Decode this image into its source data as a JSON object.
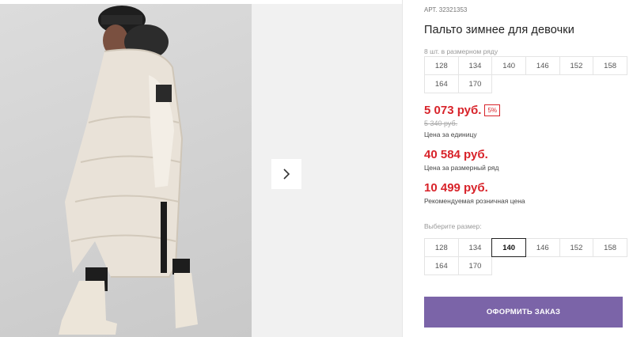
{
  "product": {
    "sku_label": "АРТ.",
    "sku_value": "32321353",
    "title": "Пальто зимнее для девочки"
  },
  "pack": {
    "caption": "8 шт. в размерном ряду",
    "sizes": [
      "128",
      "134",
      "140",
      "146",
      "152",
      "158",
      "164",
      "170"
    ]
  },
  "prices": {
    "unit_price": "5 073 руб.",
    "discount": "5%",
    "old_price": "5 340 руб.",
    "unit_label": "Цена за единицу",
    "pack_price": "40 584 руб.",
    "pack_label": "Цена за размерный ряд",
    "retail_price": "10 499 руб.",
    "retail_label": "Рекомендуемая розничная цена"
  },
  "size_select": {
    "caption": "Выберите размер:",
    "selected": "140",
    "sizes": [
      "128",
      "134",
      "140",
      "146",
      "152",
      "158",
      "164",
      "170"
    ]
  },
  "actions": {
    "order_label": "ОФОРМИТЬ ЗАКАЗ"
  },
  "colors": {
    "price_red": "#d8232a",
    "button_purple": "#7b64a8"
  },
  "icons": {
    "next": "chevron-right-icon"
  }
}
